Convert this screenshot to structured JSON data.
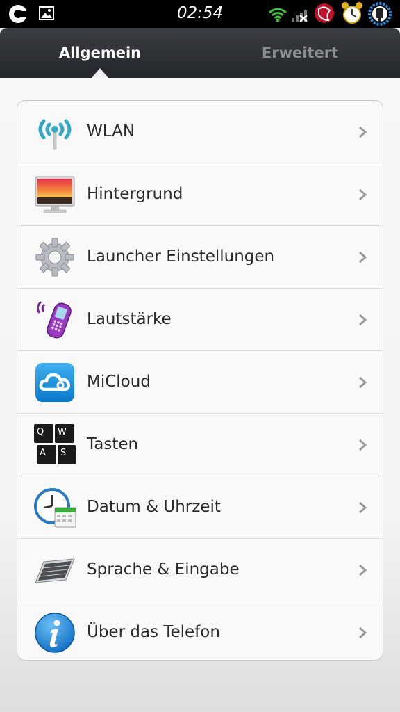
{
  "status_bar": {
    "time": "02:54",
    "icons": [
      "cyanogen-icon",
      "image-notification-icon",
      "wifi-icon",
      "signal-x-icon",
      "app-notification-icon",
      "alarm-clock-icon",
      "battery-charging-icon"
    ]
  },
  "tabs": [
    {
      "label": "Allgemein",
      "active": true
    },
    {
      "label": "Erweitert",
      "active": false
    }
  ],
  "settings": [
    {
      "label": "WLAN",
      "icon": "wlan-icon"
    },
    {
      "label": "Hintergrund",
      "icon": "wallpaper-icon"
    },
    {
      "label": "Launcher Einstellungen",
      "icon": "gear-icon"
    },
    {
      "label": "Lautstärke",
      "icon": "phone-volume-icon"
    },
    {
      "label": "MiCloud",
      "icon": "cloud-icon"
    },
    {
      "label": "Tasten",
      "icon": "keys-icon"
    },
    {
      "label": "Datum & Uhrzeit",
      "icon": "clock-calendar-icon"
    },
    {
      "label": "Sprache & Eingabe",
      "icon": "keyboard-icon"
    },
    {
      "label": "Über das Telefon",
      "icon": "info-icon"
    }
  ],
  "colors": {
    "header": "#2e3135",
    "active_tab": "#ffffff",
    "inactive_tab": "#8a8d91",
    "label": "#2a2a2a",
    "chevron": "#9a9a9a"
  }
}
